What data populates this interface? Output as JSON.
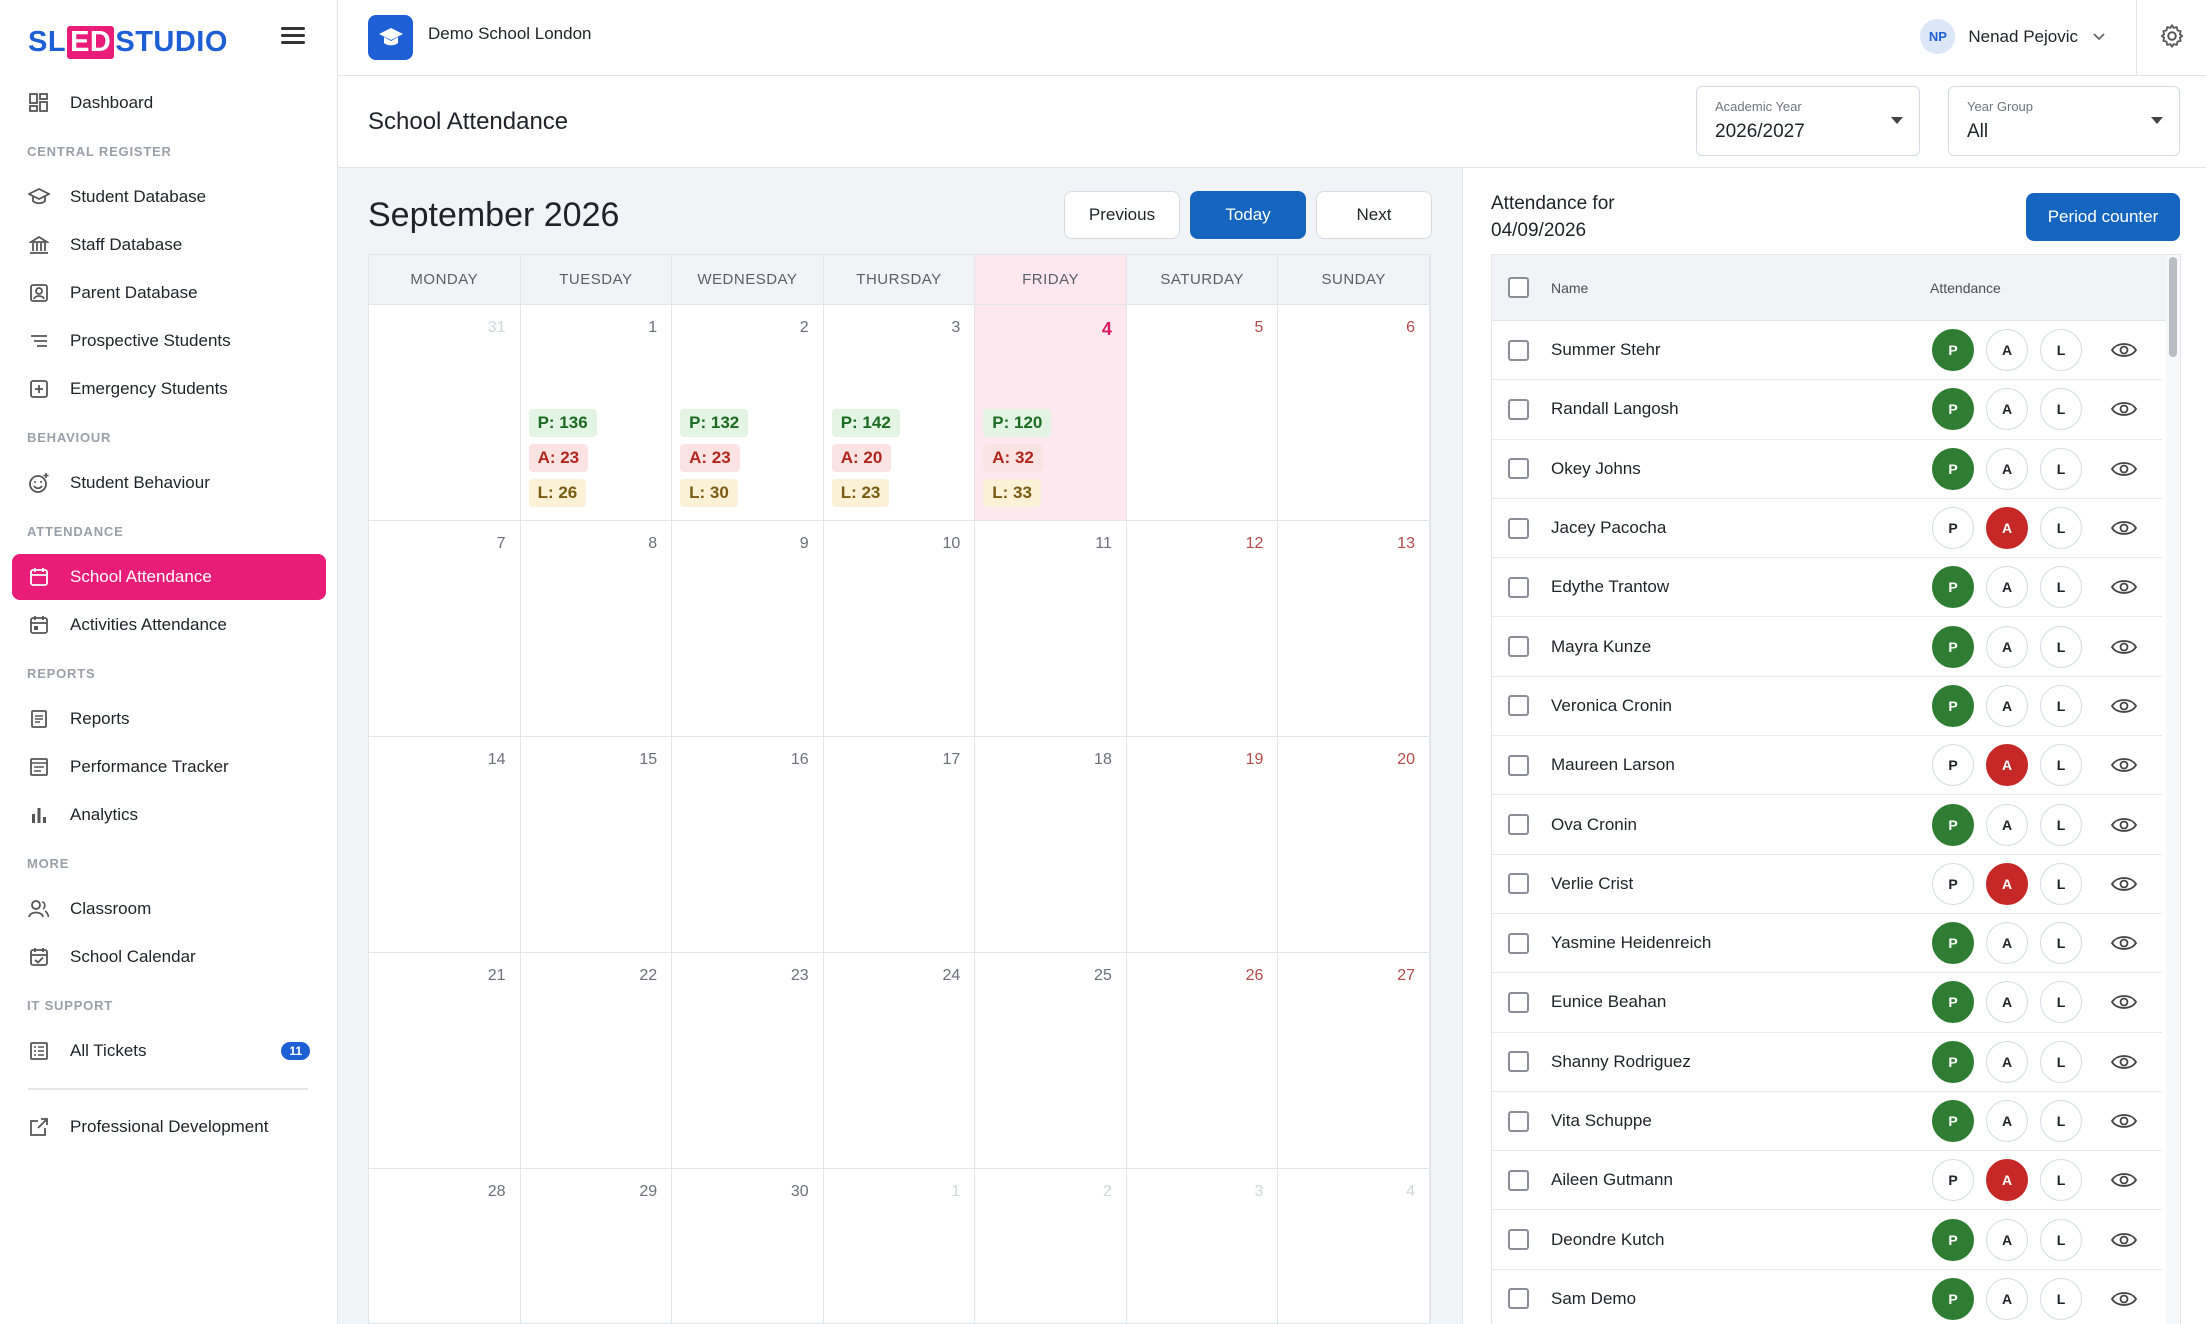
{
  "brand": {
    "part1": "SL",
    "part2": "ED",
    "part3": "STUDIO"
  },
  "topbar": {
    "school_name": "Demo School London",
    "user_initials": "NP",
    "user_name": "Nenad Pejovic"
  },
  "sidebar": {
    "dashboard": "Dashboard",
    "sections": {
      "central": "CENTRAL REGISTER",
      "behaviour": "BEHAVIOUR",
      "attendance": "ATTENDANCE",
      "reports": "REPORTS",
      "more": "MORE",
      "it": "IT SUPPORT"
    },
    "items": {
      "student_db": "Student Database",
      "staff_db": "Staff Database",
      "parent_db": "Parent Database",
      "prospective": "Prospective Students",
      "emergency": "Emergency Students",
      "student_behaviour": "Student Behaviour",
      "school_attendance": "School Attendance",
      "activities_attendance": "Activities Attendance",
      "reports": "Reports",
      "performance": "Performance Tracker",
      "analytics": "Analytics",
      "classroom": "Classroom",
      "school_calendar": "School Calendar",
      "all_tickets": "All Tickets",
      "tickets_count": "11",
      "prof_dev": "Professional Development"
    }
  },
  "header": {
    "page_title": "School Attendance",
    "academic_year_label": "Academic Year",
    "academic_year_value": "2026/2027",
    "year_group_label": "Year Group",
    "year_group_value": "All"
  },
  "calendar": {
    "title": "September 2026",
    "previous": "Previous",
    "today": "Today",
    "next": "Next",
    "days": [
      "MONDAY",
      "TUESDAY",
      "WEDNESDAY",
      "THURSDAY",
      "FRIDAY",
      "SATURDAY",
      "SUNDAY"
    ],
    "weeks": [
      [
        "31",
        "1",
        "2",
        "3",
        "4",
        "5",
        "6"
      ],
      [
        "7",
        "8",
        "9",
        "10",
        "11",
        "12",
        "13"
      ],
      [
        "14",
        "15",
        "16",
        "17",
        "18",
        "19",
        "20"
      ],
      [
        "21",
        "22",
        "23",
        "24",
        "25",
        "26",
        "27"
      ],
      [
        "28",
        "29",
        "30",
        "1",
        "2",
        "3",
        "4"
      ]
    ],
    "stats": [
      {
        "p": "P: 136",
        "a": "A: 23",
        "l": "L: 26"
      },
      {
        "p": "P: 132",
        "a": "A: 23",
        "l": "L: 30"
      },
      {
        "p": "P: 142",
        "a": "A: 20",
        "l": "L: 23"
      },
      {
        "p": "P: 120",
        "a": "A: 32",
        "l": "L: 33"
      }
    ]
  },
  "panel": {
    "title_line1": "Attendance for",
    "title_line2": "04/09/2026",
    "period_counter": "Period counter",
    "col_name": "Name",
    "col_attendance": "Attendance",
    "chip_p": "P",
    "chip_a": "A",
    "chip_l": "L",
    "students": [
      {
        "name": "Summer Stehr",
        "status": "P"
      },
      {
        "name": "Randall Langosh",
        "status": "P"
      },
      {
        "name": "Okey Johns",
        "status": "P"
      },
      {
        "name": "Jacey Pacocha",
        "status": "A"
      },
      {
        "name": "Edythe Trantow",
        "status": "P"
      },
      {
        "name": "Mayra Kunze",
        "status": "P"
      },
      {
        "name": "Veronica Cronin",
        "status": "P"
      },
      {
        "name": "Maureen Larson",
        "status": "A"
      },
      {
        "name": "Ova Cronin",
        "status": "P"
      },
      {
        "name": "Verlie Crist",
        "status": "A"
      },
      {
        "name": "Yasmine Heidenreich",
        "status": "P"
      },
      {
        "name": "Eunice Beahan",
        "status": "P"
      },
      {
        "name": "Shanny Rodriguez",
        "status": "P"
      },
      {
        "name": "Vita Schuppe",
        "status": "P"
      },
      {
        "name": "Aileen Gutmann",
        "status": "A"
      },
      {
        "name": "Deondre Kutch",
        "status": "P"
      },
      {
        "name": "Sam Demo",
        "status": "P"
      }
    ]
  },
  "colors": {
    "brand_blue": "#1f5fd6",
    "accent_pink": "#ea1c79",
    "present_green": "#2e7d32",
    "absent_red": "#c62828",
    "primary_button": "#1565c0"
  }
}
